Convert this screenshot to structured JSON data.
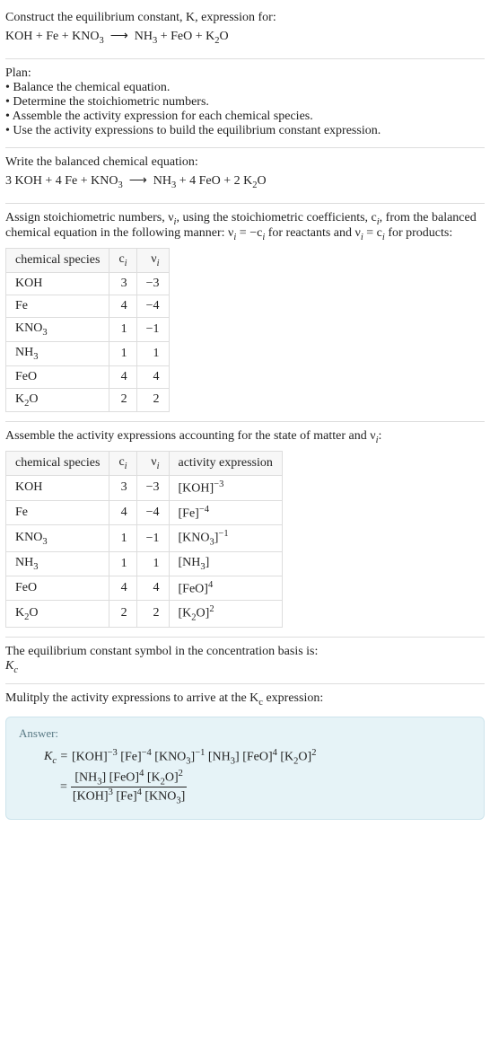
{
  "header": {
    "line1": "Construct the equilibrium constant, K, expression for:",
    "equation_html": "KOH + Fe + KNO<sub>3</sub>&nbsp;&nbsp;⟶&nbsp;&nbsp;NH<sub>3</sub> + FeO + K<sub>2</sub>O"
  },
  "plan": {
    "title": "Plan:",
    "bullets": [
      "• Balance the chemical equation.",
      "• Determine the stoichiometric numbers.",
      "• Assemble the activity expression for each chemical species.",
      "• Use the activity expressions to build the equilibrium constant expression."
    ]
  },
  "balanced": {
    "title": "Write the balanced chemical equation:",
    "equation_html": "3 KOH + 4 Fe + KNO<sub>3</sub>&nbsp;&nbsp;⟶&nbsp;&nbsp;NH<sub>3</sub> + 4 FeO + 2 K<sub>2</sub>O"
  },
  "stoich": {
    "intro_html": "Assign stoichiometric numbers, ν<sub><i>i</i></sub>, using the stoichiometric coefficients, c<sub><i>i</i></sub>, from the balanced chemical equation in the following manner: ν<sub><i>i</i></sub> = −c<sub><i>i</i></sub> for reactants and ν<sub><i>i</i></sub> = c<sub><i>i</i></sub> for products:",
    "headers": {
      "species": "chemical species",
      "ci_html": "c<sub><i>i</i></sub>",
      "vi_html": "ν<sub><i>i</i></sub>"
    },
    "rows": [
      {
        "species_html": "KOH",
        "ci": "3",
        "vi": "−3"
      },
      {
        "species_html": "Fe",
        "ci": "4",
        "vi": "−4"
      },
      {
        "species_html": "KNO<sub>3</sub>",
        "ci": "1",
        "vi": "−1"
      },
      {
        "species_html": "NH<sub>3</sub>",
        "ci": "1",
        "vi": "1"
      },
      {
        "species_html": "FeO",
        "ci": "4",
        "vi": "4"
      },
      {
        "species_html": "K<sub>2</sub>O",
        "ci": "2",
        "vi": "2"
      }
    ]
  },
  "activity": {
    "intro_html": "Assemble the activity expressions accounting for the state of matter and ν<sub><i>i</i></sub>:",
    "headers": {
      "species": "chemical species",
      "ci_html": "c<sub><i>i</i></sub>",
      "vi_html": "ν<sub><i>i</i></sub>",
      "activity": "activity expression"
    },
    "rows": [
      {
        "species_html": "KOH",
        "ci": "3",
        "vi": "−3",
        "act_html": "[KOH]<sup>−3</sup>"
      },
      {
        "species_html": "Fe",
        "ci": "4",
        "vi": "−4",
        "act_html": "[Fe]<sup>−4</sup>"
      },
      {
        "species_html": "KNO<sub>3</sub>",
        "ci": "1",
        "vi": "−1",
        "act_html": "[KNO<sub>3</sub>]<sup>−1</sup>"
      },
      {
        "species_html": "NH<sub>3</sub>",
        "ci": "1",
        "vi": "1",
        "act_html": "[NH<sub>3</sub>]"
      },
      {
        "species_html": "FeO",
        "ci": "4",
        "vi": "4",
        "act_html": "[FeO]<sup>4</sup>"
      },
      {
        "species_html": "K<sub>2</sub>O",
        "ci": "2",
        "vi": "2",
        "act_html": "[K<sub>2</sub>O]<sup>2</sup>"
      }
    ]
  },
  "kc_symbol": {
    "line1": "The equilibrium constant symbol in the concentration basis is:",
    "symbol_html": "K<sub>c</sub>"
  },
  "multiply": {
    "line_html": "Mulitply the activity expressions to arrive at the K<sub>c</sub> expression:"
  },
  "answer": {
    "label": "Answer:",
    "kc_html": "K<sub>c</sub> = ",
    "flat_html": "[KOH]<sup>−3</sup> [Fe]<sup>−4</sup> [KNO<sub>3</sub>]<sup>−1</sup> [NH<sub>3</sub>] [FeO]<sup>4</sup> [K<sub>2</sub>O]<sup>2</sup>",
    "eq2_prefix": "= ",
    "frac_num_html": "[NH<sub>3</sub>] [FeO]<sup>4</sup> [K<sub>2</sub>O]<sup>2</sup>",
    "frac_den_html": "[KOH]<sup>3</sup> [Fe]<sup>4</sup> [KNO<sub>3</sub>]"
  }
}
